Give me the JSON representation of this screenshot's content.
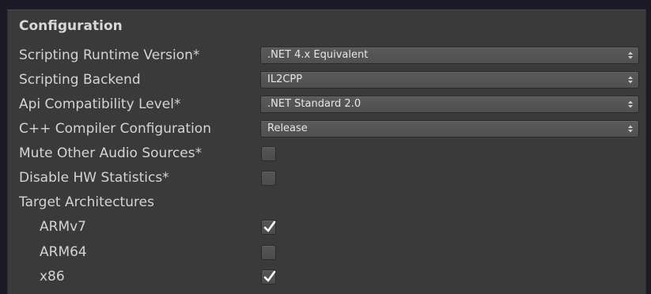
{
  "section": {
    "title": "Configuration"
  },
  "rows": {
    "scripting_runtime": {
      "label": "Scripting Runtime Version*",
      "value": ".NET 4.x Equivalent"
    },
    "scripting_backend": {
      "label": "Scripting Backend",
      "value": "IL2CPP"
    },
    "api_compat": {
      "label": "Api Compatibility Level*",
      "value": ".NET Standard 2.0"
    },
    "cpp_compiler": {
      "label": "C++ Compiler Configuration",
      "value": "Release"
    },
    "mute_audio": {
      "label": "Mute Other Audio Sources*",
      "checked": false
    },
    "disable_hw_stats": {
      "label": "Disable HW Statistics*",
      "checked": false
    },
    "target_arch": {
      "label": "Target Architectures"
    },
    "armv7": {
      "label": "ARMv7",
      "checked": true
    },
    "arm64": {
      "label": "ARM64",
      "checked": false
    },
    "x86": {
      "label": "x86",
      "checked": true
    }
  },
  "icons": {
    "dropdown": "updown-arrows-icon",
    "check": "checkmark-icon"
  }
}
